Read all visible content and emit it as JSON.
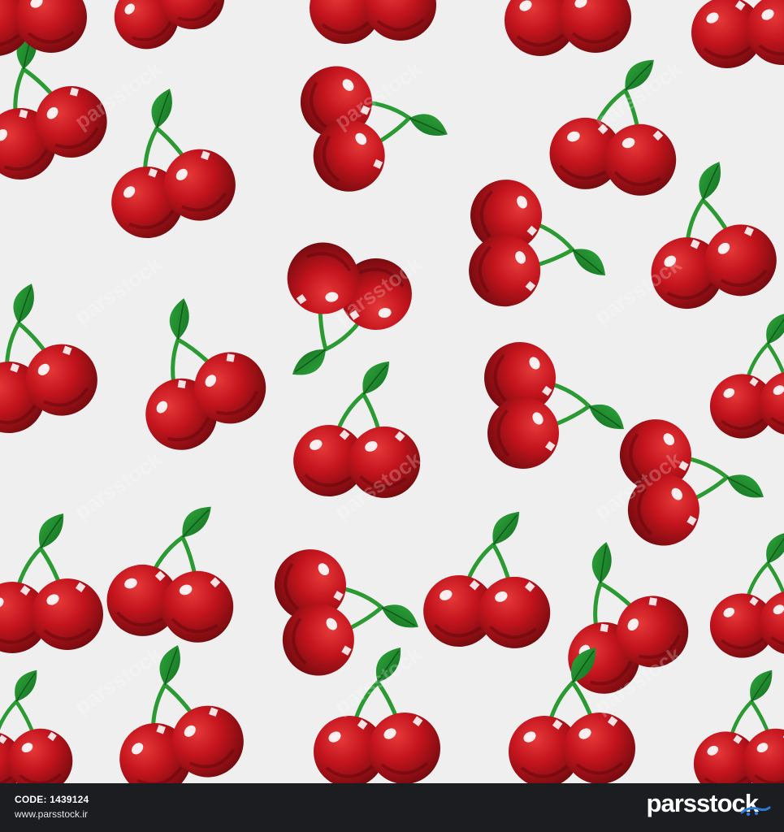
{
  "image": {
    "background_color": "#efefef",
    "subject": "cherry pairs with green stems and leaves, repeating pattern",
    "cherry_color": "#c4141d",
    "leaf_color": "#1f8a2c",
    "stem_color": "#2b9a33"
  },
  "watermark": {
    "text": "parsstock"
  },
  "footer": {
    "code_label": "CODE: 1439124",
    "site_url": "www.parsstock.ir",
    "brand_name": "parsstock",
    "background_color": "#1b1d20"
  }
}
